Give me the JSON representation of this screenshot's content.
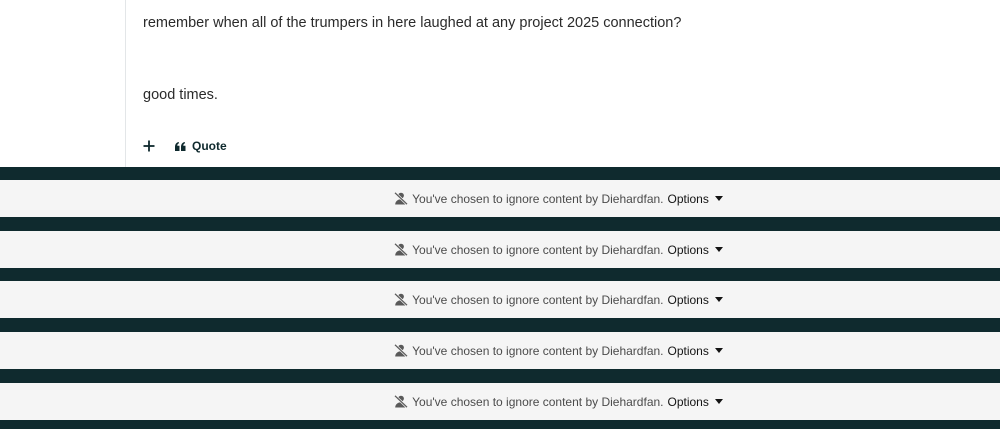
{
  "post": {
    "line1": "remember when all of the trumpers in here laughed at any project 2025 connection?",
    "line2": "good times.",
    "quote_label": "Quote",
    "plus_icon": "plus-icon",
    "quote_icon": "quote-icon"
  },
  "ignored_posts": [
    {
      "message": "You've chosen to ignore content by Diehardfan.",
      "options_label": "Options"
    },
    {
      "message": "You've chosen to ignore content by Diehardfan.",
      "options_label": "Options"
    },
    {
      "message": "You've chosen to ignore content by Diehardfan.",
      "options_label": "Options"
    },
    {
      "message": "You've chosen to ignore content by Diehardfan.",
      "options_label": "Options"
    },
    {
      "message": "You've chosen to ignore content by Diehardfan.",
      "options_label": "Options"
    }
  ],
  "colors": {
    "page_background": "#0f2a2e",
    "post_background": "#ffffff",
    "ignored_background": "#f5f5f5",
    "accent": "#0f2a2e"
  }
}
